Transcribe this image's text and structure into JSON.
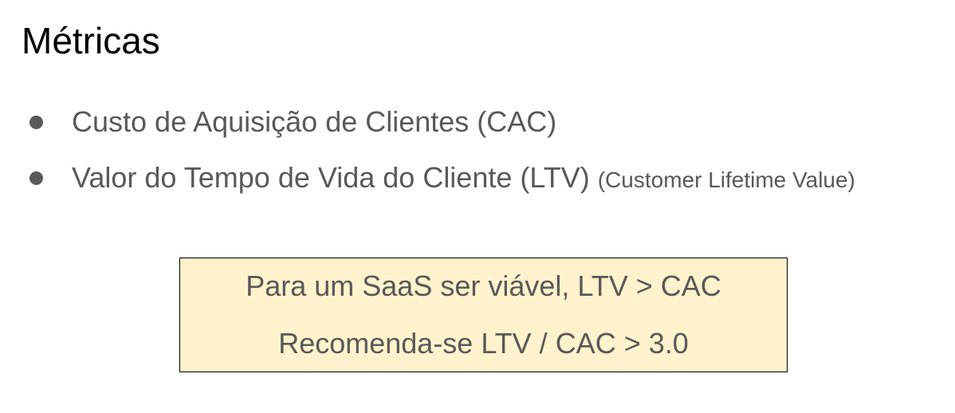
{
  "title": "Métricas",
  "bullets": [
    {
      "text": "Custo de Aquisição de Clientes (CAC)",
      "note": ""
    },
    {
      "text": "Valor do Tempo de Vida do Cliente (LTV)",
      "note": "(Customer Lifetime Value)"
    }
  ],
  "callout": {
    "line1": "Para um SaaS ser viável, LTV > CAC",
    "line2": "Recomenda-se LTV / CAC > 3.0"
  },
  "colors": {
    "text": "#595959",
    "title": "#000000",
    "callout_bg": "#fff2cc",
    "callout_border": "#000000"
  }
}
